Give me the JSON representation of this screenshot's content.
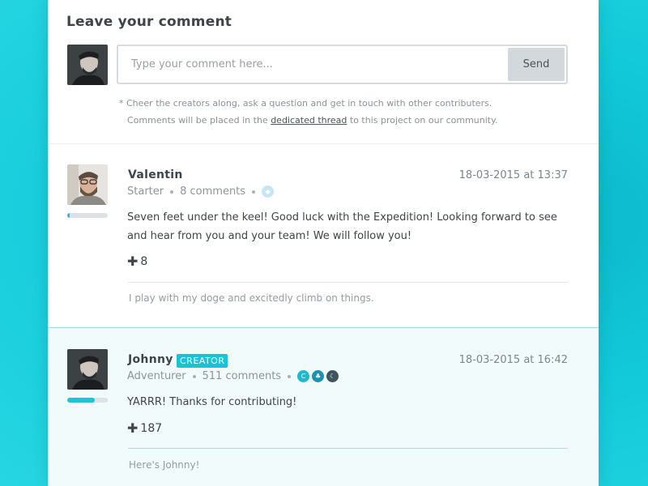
{
  "compose": {
    "title": "Leave your comment",
    "placeholder": "Type your comment here...",
    "send_label": "Send",
    "note_line1": "* Cheer the creators along, ask a question and get in touch with other contributers.",
    "note_pre": "Comments will be placed in the ",
    "note_link": "dedicated thread",
    "note_post": " to this project on our community."
  },
  "comments": [
    {
      "name": "Valentin",
      "rank": "Starter",
      "count": "8 comments",
      "date": "18-03-2015 at 13:37",
      "body": "Seven feet under the keel! Good luck with the Expedition! Looking forward to see and hear from you and your team! We will follow you!",
      "votes": "8",
      "signature": "I play with my doge and excitedly climb on things.",
      "progress": 0.06,
      "badges": [
        {
          "icon": "diamond-icon",
          "color": "#c7e6f4"
        }
      ]
    },
    {
      "name": "Johnny",
      "tag": "CREATOR",
      "rank": "Adventurer",
      "count": "511 comments",
      "date": "18-03-2015 at 16:42",
      "body": "YARRR! Thanks for contributing!",
      "votes": "187",
      "signature": "Here's Johnny!",
      "progress": 0.68,
      "badges": [
        {
          "icon": "c-badge-icon",
          "color": "#1fb8cf"
        },
        {
          "icon": "club-icon",
          "color": "#1a93b2"
        },
        {
          "icon": "moon-icon",
          "color": "#3e5560"
        }
      ]
    }
  ],
  "colors": {
    "accent": "#1ec3d5",
    "background": "#12c9d9"
  }
}
